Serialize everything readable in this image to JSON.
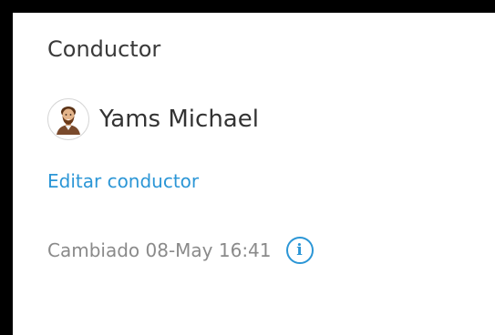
{
  "driver_panel": {
    "title": "Conductor",
    "driver": {
      "name": "Yams Michael",
      "avatar_icon": "bearded-man-avatar-icon"
    },
    "edit_link": "Editar conductor",
    "changed_label": "Cambiado 08-May 16:41",
    "info_icon": "info-icon",
    "info_glyph": "i",
    "colors": {
      "link": "#2b96d6",
      "muted_text": "#8a8a8a",
      "title_text": "#3a3a3a",
      "frame": "#000000"
    }
  }
}
